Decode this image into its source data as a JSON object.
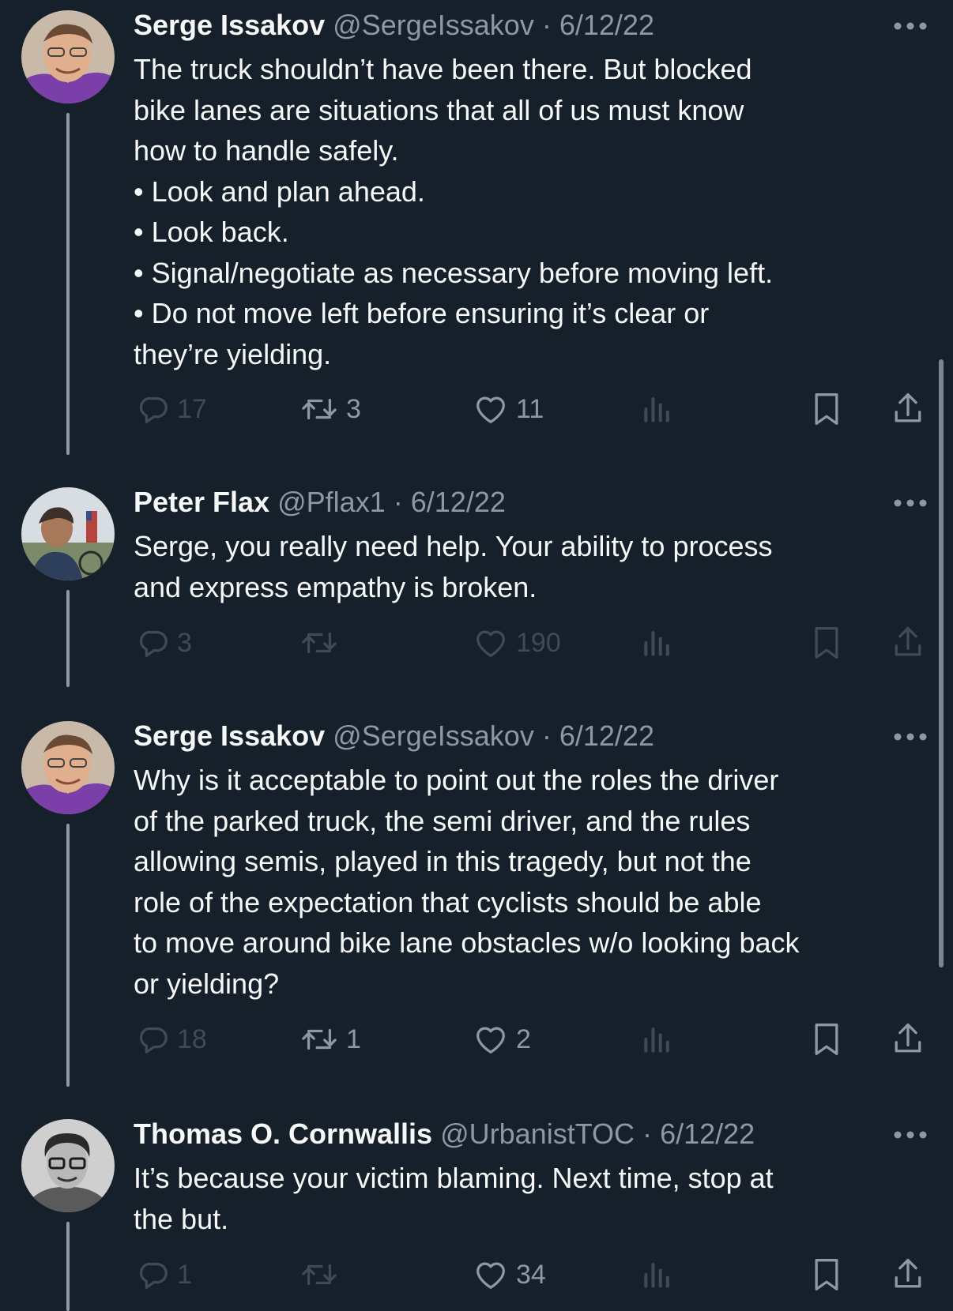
{
  "thread": {
    "tweets": [
      {
        "name": "Serge Issakov",
        "handle": "@SergeIssakov",
        "sep": "·",
        "date": "6/12/22",
        "avatar_icon": "person-avatar-icon",
        "lines": [
          "The truck shouldn’t have been there. But blocked",
          "bike lanes are situations that all of us must know",
          "how to handle safely.",
          "• Look and plan ahead.",
          "• Look back.",
          "• Signal/negotiate as necessary before moving left.",
          "• Do not move left before ensuring it’s clear or",
          "they’re yielding."
        ],
        "replies": "17",
        "retweets": "3",
        "likes": "11"
      },
      {
        "name": "Peter Flax",
        "handle": "@Pflax1",
        "sep": "·",
        "date": "6/12/22",
        "avatar_icon": "person-avatar-icon",
        "lines": [
          "Serge, you really need help. Your ability to process",
          "and express empathy is broken."
        ],
        "replies": "3",
        "retweets": "",
        "likes": "190"
      },
      {
        "name": "Serge Issakov",
        "handle": "@SergeIssakov",
        "sep": "·",
        "date": "6/12/22",
        "avatar_icon": "person-avatar-icon",
        "lines": [
          "Why is it acceptable to point out the roles the driver",
          "of the parked truck, the semi driver, and the rules",
          "allowing  semis, played in this tragedy, but not the",
          "role of the expectation that cyclists should be able",
          "to move around bike lane obstacles w/o looking back",
          "or yielding?"
        ],
        "replies": "18",
        "retweets": "1",
        "likes": "2"
      },
      {
        "name": "Thomas O. Cornwallis",
        "handle": "@UrbanistTOC",
        "sep": "·",
        "date": "6/12/22",
        "avatar_icon": "person-avatar-icon",
        "lines": [
          "It’s because your victim blaming. Next time, stop at",
          "the but."
        ],
        "replies": "1",
        "retweets": "",
        "likes": "34"
      }
    ]
  },
  "icons": {
    "reply": "reply-icon",
    "retweet": "retweet-icon",
    "like": "heart-icon",
    "views": "analytics-icon",
    "bookmark": "bookmark-icon",
    "share": "share-icon",
    "more": "more-icon"
  },
  "colors": {
    "background": "#15202b",
    "text": "#f7f9f9",
    "secondary": "#8b98a5",
    "thread_line": "#8b98a5"
  }
}
